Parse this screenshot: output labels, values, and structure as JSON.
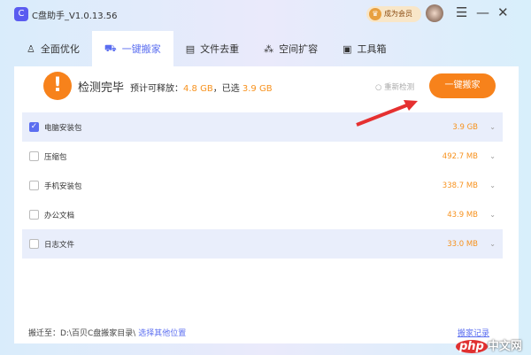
{
  "app": {
    "title": "C盘助手_V1.0.13.56",
    "vip_label": "成为会员"
  },
  "tabs": [
    {
      "label": "全面优化",
      "icon": "rocket-icon"
    },
    {
      "label": "一键搬家",
      "icon": "truck-icon"
    },
    {
      "label": "文件去重",
      "icon": "file-copy-icon"
    },
    {
      "label": "空间扩容",
      "icon": "expand-icon"
    },
    {
      "label": "工具箱",
      "icon": "toolbox-icon"
    }
  ],
  "header": {
    "status": "检测完毕",
    "summary_prefix": "预计可释放：",
    "releasable": "4.8 GB",
    "selected_prefix": "，已选",
    "selected": "3.9 GB",
    "recheck_label": "重新检测",
    "main_button": "一键搬家"
  },
  "items": [
    {
      "name": "电脑安装包",
      "size": "3.9 GB",
      "checked": true
    },
    {
      "name": "压缩包",
      "size": "492.7 MB",
      "checked": false
    },
    {
      "name": "手机安装包",
      "size": "338.7 MB",
      "checked": false
    },
    {
      "name": "办公文档",
      "size": "43.9 MB",
      "checked": false
    },
    {
      "name": "日志文件",
      "size": "33.0 MB",
      "checked": false
    }
  ],
  "footer": {
    "prefix": "搬迁至：",
    "path": "D:\\百贝C盘搬家目录\\",
    "choose_label": "选择其他位置",
    "records_label": "搬家记录"
  },
  "watermark": {
    "text1": "php",
    "text2": "中文网"
  },
  "colors": {
    "accent": "#5b6ef0",
    "orange": "#f7821b"
  }
}
